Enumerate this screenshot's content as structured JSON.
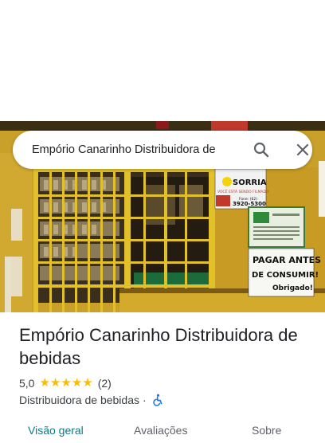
{
  "search": {
    "query": "Empório Canarinho Distribuidora de"
  },
  "photo": {
    "alt": "Storefront photo",
    "signs": {
      "sorria": "SORRIA",
      "filmado": "VOCÊ ESTÁ SENDO FILMADO",
      "fone_label": "Fone: (62)",
      "fone_number": "3920-5300",
      "pagar_line1": "PAGAR ANTES",
      "pagar_line2": "DE CONSUMIR!",
      "pagar_line3": "Obrigado!"
    }
  },
  "place": {
    "name": "Empório Canarinho Distribuidora de bebidas",
    "rating": "5,0",
    "stars": [
      "★",
      "★",
      "★",
      "★",
      "★"
    ],
    "review_count": "(2)",
    "category": "Distribuidora de bebidas",
    "separator": "·"
  },
  "tabs": [
    {
      "label": "Visão geral"
    },
    {
      "label": "Avaliações"
    },
    {
      "label": "Sobre"
    }
  ],
  "colors": {
    "star": "#fbbc04",
    "active_tab": "#0b7a8a",
    "accessibility": "#1a73e8"
  },
  "icons": {
    "search": "search-icon",
    "close": "close-icon",
    "accessibility": "wheelchair-icon"
  }
}
